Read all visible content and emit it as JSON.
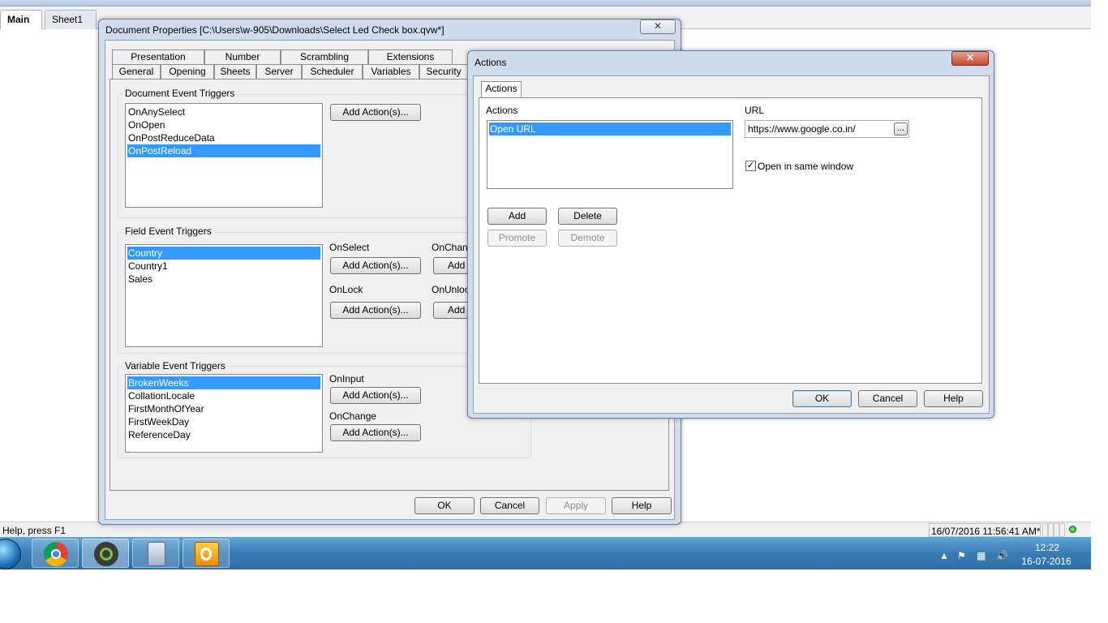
{
  "app_tabs": [
    "Main",
    "Sheet1"
  ],
  "status": {
    "help_text": "Help, press F1",
    "timestamp": "16/07/2016 11:56:41 AM*"
  },
  "taskbar": {
    "time": "12:22",
    "date": "16-07-2016",
    "apps": [
      "chrome-icon",
      "qlikview-icon",
      "calculator-icon",
      "outlook-icon"
    ]
  },
  "doc_props": {
    "title": "Document Properties [C:\\Users\\w-905\\Downloads\\Select Led Check box.qvw*]",
    "tabs_row1": [
      "Presentation",
      "Number",
      "Scrambling",
      "Extensions"
    ],
    "tabs_row2": [
      "General",
      "Opening",
      "Sheets",
      "Server",
      "Scheduler",
      "Variables",
      "Security"
    ],
    "doc_events_label": "Document Event Triggers",
    "doc_events": [
      "OnAnySelect",
      "OnOpen",
      "OnPostReduceData",
      "OnPostReload"
    ],
    "doc_events_selected": "OnPostReload",
    "add_action_label": "Add Action(s)...",
    "field_events_label": "Field Event Triggers",
    "fields": [
      "Country",
      "Country1",
      "Sales"
    ],
    "fields_selected": "Country",
    "on_select": "OnSelect",
    "on_change": "OnChang",
    "on_lock": "OnLock",
    "on_unlock": "OnUnlock",
    "add_partial": "Add",
    "variable_events_label": "Variable Event Triggers",
    "variables": [
      "BrokenWeeks",
      "CollationLocale",
      "FirstMonthOfYear",
      "FirstWeekDay",
      "ReferenceDay"
    ],
    "variables_selected": "BrokenWeeks",
    "on_input": "OnInput",
    "on_change_full": "OnChange",
    "ok": "OK",
    "cancel": "Cancel",
    "apply": "Apply",
    "help": "Help",
    "close_symbol": "✕"
  },
  "actions_dialog": {
    "title": "Actions",
    "tab": "Actions",
    "actions_label": "Actions",
    "actions_list": [
      "Open URL"
    ],
    "url_label": "URL",
    "url_value": "https://www.google.co.in/",
    "browse_label": "...",
    "open_same_window": "Open in same window",
    "open_same_window_checked": true,
    "add": "Add",
    "delete": "Delete",
    "promote": "Promote",
    "demote": "Demote",
    "ok": "OK",
    "cancel": "Cancel",
    "help": "Help",
    "close_symbol": "✕"
  }
}
